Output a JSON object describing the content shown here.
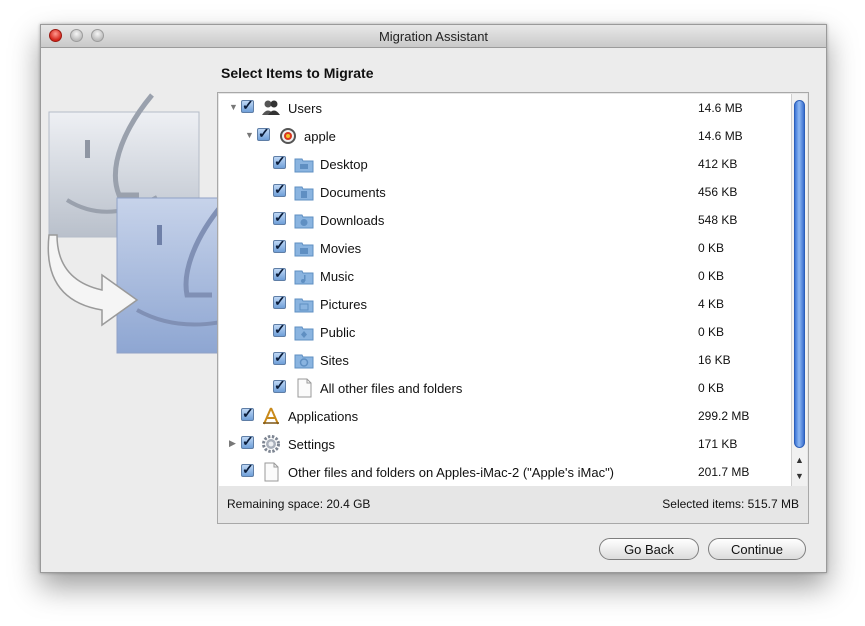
{
  "window": {
    "title": "Migration Assistant"
  },
  "header": {
    "title": "Select Items to Migrate"
  },
  "items": [
    {
      "label": "Users",
      "size": "14.6 MB",
      "icon": "users-icon",
      "expanded": true,
      "checked": true
    },
    {
      "label": "apple",
      "size": "14.6 MB",
      "icon": "user-avatar-icon",
      "expanded": true,
      "checked": true
    },
    {
      "label": "Desktop",
      "size": "412 KB",
      "icon": "folder-icon",
      "checked": true
    },
    {
      "label": "Documents",
      "size": "456 KB",
      "icon": "folder-icon",
      "checked": true
    },
    {
      "label": "Downloads",
      "size": "548 KB",
      "icon": "folder-icon",
      "checked": true
    },
    {
      "label": "Movies",
      "size": "0 KB",
      "icon": "folder-icon",
      "checked": true
    },
    {
      "label": "Music",
      "size": "0 KB",
      "icon": "folder-icon",
      "checked": true
    },
    {
      "label": "Pictures",
      "size": "4 KB",
      "icon": "folder-icon",
      "checked": true
    },
    {
      "label": "Public",
      "size": "0 KB",
      "icon": "folder-icon",
      "checked": true
    },
    {
      "label": "Sites",
      "size": "16 KB",
      "icon": "folder-icon",
      "checked": true
    },
    {
      "label": "All other files and folders",
      "size": "0 KB",
      "icon": "document-icon",
      "checked": true
    },
    {
      "label": "Applications",
      "size": "299.2 MB",
      "icon": "applications-icon",
      "checked": true
    },
    {
      "label": "Settings",
      "size": "171 KB",
      "icon": "gear-icon",
      "expanded": false,
      "checked": true
    },
    {
      "label": "Other files and folders on Apples-iMac-2 (\"Apple's iMac\")",
      "size": "201.7 MB",
      "icon": "document-icon",
      "checked": true
    }
  ],
  "footer": {
    "remaining": "Remaining space: 20.4 GB",
    "selected": "Selected items: 515.7 MB"
  },
  "buttons": {
    "back": "Go Back",
    "continue": "Continue"
  },
  "colors": {
    "checkbox": "#6f9fd8",
    "scroll_thumb": "#3b74d6",
    "close_button": "#d4241a"
  }
}
